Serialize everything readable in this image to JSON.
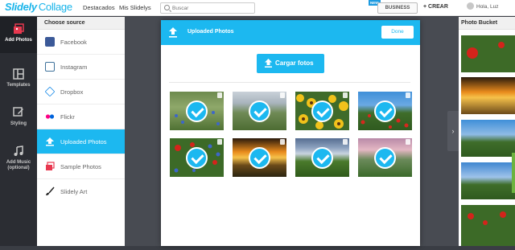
{
  "header": {
    "logo_main": "Slidely",
    "logo_sub": "Collage",
    "nav": [
      "Destacados",
      "Mis Slidelys"
    ],
    "search_placeholder": "Buscar",
    "new_badge": "NEW",
    "business_label": "BUSINESS",
    "create_label": "+ CREAR",
    "user_greeting": "Hola, Luz"
  },
  "rail": [
    {
      "label": "Add Photos",
      "icon": "add-photos-icon",
      "active": true
    },
    {
      "label": "Templates",
      "icon": "templates-icon",
      "active": false
    },
    {
      "label": "Styling",
      "icon": "styling-icon",
      "active": false
    },
    {
      "label": "Add Music (optional)",
      "icon": "music-icon",
      "active": false
    }
  ],
  "sources": {
    "title": "Choose source",
    "items": [
      {
        "label": "Facebook",
        "icon": "facebook-icon",
        "active": false
      },
      {
        "label": "Instagram",
        "icon": "instagram-icon",
        "active": false
      },
      {
        "label": "Dropbox",
        "icon": "dropbox-icon",
        "active": false
      },
      {
        "label": "Flickr",
        "icon": "flickr-icon",
        "active": false
      },
      {
        "label": "Uploaded Photos",
        "icon": "upload-icon",
        "active": true
      },
      {
        "label": "Sample Photos",
        "icon": "sample-photos-icon",
        "active": false
      },
      {
        "label": "Slidely Art",
        "icon": "brush-icon",
        "active": false
      }
    ]
  },
  "modal": {
    "title": "Uploaded Photos",
    "done_label": "Done",
    "upload_label": "Cargar fotos",
    "photos": [
      {
        "subject": "green field with blue flowers",
        "selected": true
      },
      {
        "subject": "green wheat field",
        "selected": true
      },
      {
        "subject": "sunflowers",
        "selected": true
      },
      {
        "subject": "red poppies with trees",
        "selected": true
      },
      {
        "subject": "red poppies and blue flowers",
        "selected": true
      },
      {
        "subject": "sunset field",
        "selected": true
      },
      {
        "subject": "cloudy green field",
        "selected": true
      },
      {
        "subject": "pink sky over field",
        "selected": true
      }
    ]
  },
  "bucket": {
    "title": "Photo Bucket"
  },
  "colors": {
    "accent": "#1cb8f0",
    "rail_bg": "#2b2d33",
    "workspace_bg": "#484b52"
  }
}
